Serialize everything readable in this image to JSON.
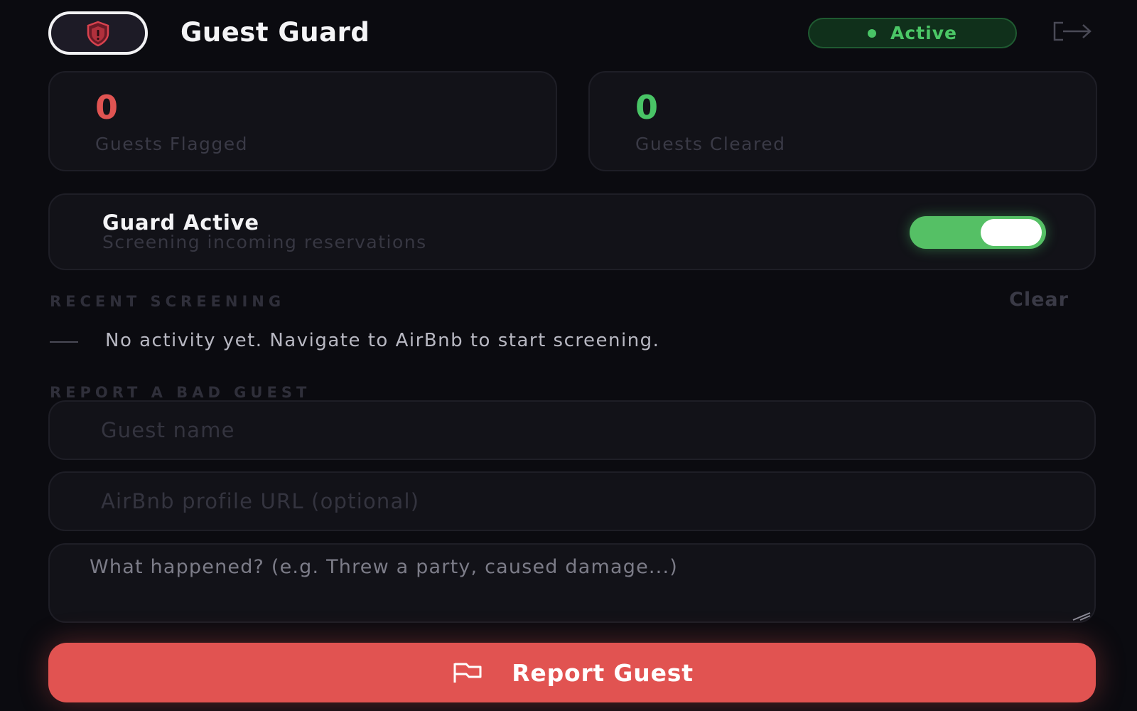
{
  "header": {
    "title": "Guest Guard",
    "logo_icon": "shield-icon",
    "status": "Active",
    "status_color": "#49c466",
    "logout_icon": "logout-icon"
  },
  "stats": {
    "flagged_value": "0",
    "flagged_label": "Guests Flagged",
    "flagged_color": "#e05452",
    "cleared_value": "0",
    "cleared_label": "Guests Cleared",
    "cleared_color": "#49c466"
  },
  "guard": {
    "title": "Guard Active",
    "subtitle": "Screening incoming reservations",
    "enabled": true
  },
  "recent": {
    "heading": "RECENT SCREENING",
    "clear_label": "Clear",
    "empty_text": "No activity yet. Navigate to AirBnb to start screening."
  },
  "report": {
    "heading": "REPORT A BAD GUEST",
    "name_placeholder": "Guest name",
    "url_placeholder": "AirBnb profile URL (optional)",
    "notes_placeholder": "What happened? (e.g. Threw a party, caused damage...)",
    "button_label": "Report Guest",
    "button_icon": "flag-icon",
    "button_color": "#e15351"
  }
}
